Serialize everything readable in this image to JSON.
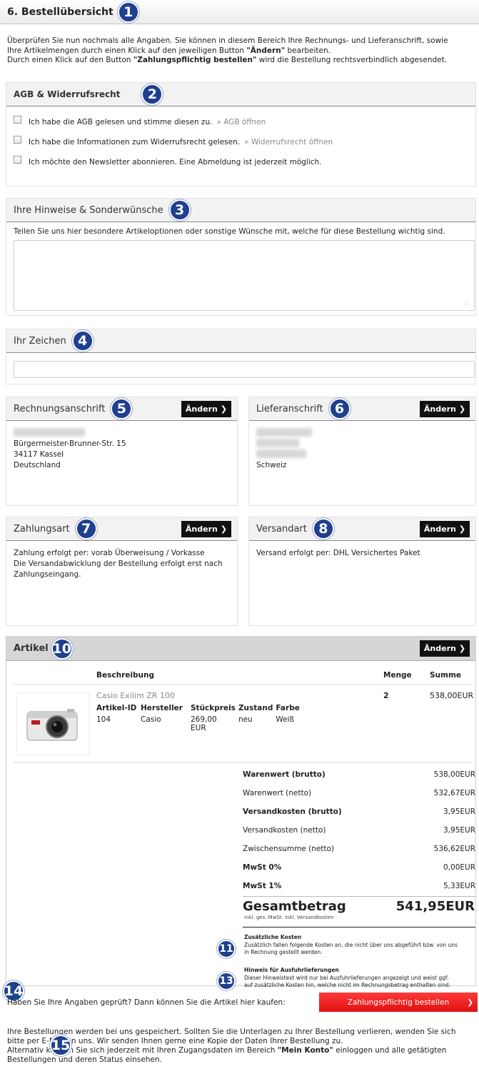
{
  "header": {
    "title": "6. Bestellübersicht",
    "badge": "1"
  },
  "intro": {
    "line1": "Überprüfen Sie nun nochmals alle Angaben. Sie können in diesem Bereich Ihre Rechnungs- und Lieferanschrift, sowie",
    "line2a": "Ihre Artikelmengen durch einen Klick auf den jeweiligen Button ",
    "line2b": "\"Ändern\"",
    "line2c": " bearbeiten.",
    "line3a": "Durch einen Klick auf den Button ",
    "line3b": "\"Zahlungspflichtig bestellen\"",
    "line3c": " wird die Bestellung rechtsverbindlich abgesendet."
  },
  "agb": {
    "title": "AGB & Widerrufsrecht",
    "badge": "2",
    "items": [
      {
        "label": "Ich habe die AGB gelesen und stimme diesen zu.",
        "link": "» AGB öffnen"
      },
      {
        "label": "Ich habe die Informationen zum Widerrufsrecht gelesen.",
        "link": "» Widerrufsrecht öffnen"
      },
      {
        "label": "Ich möchte den Newsletter abonnieren. Eine Abmeldung ist jederzeit möglich.",
        "link": ""
      }
    ]
  },
  "notes": {
    "title": "Ihre Hinweise & Sonderwünsche",
    "badge": "3",
    "desc": "Teilen Sie uns hier besondere Artikeloptionen oder sonstige Wünsche mit, welche für diese Bestellung wichtig sind.",
    "value": ""
  },
  "ref": {
    "title": "Ihr Zeichen",
    "badge": "4",
    "value": ""
  },
  "billing": {
    "title": "Rechnungsanschrift",
    "badge": "5",
    "button": "Ändern",
    "street": "Bürgermeister-Brunner-Str. 15",
    "city": "34117 Kassel",
    "country": "Deutschland"
  },
  "shipping": {
    "title": "Lieferanschrift",
    "badge": "6",
    "button": "Ändern",
    "country": "Schweiz"
  },
  "payment": {
    "title": "Zahlungsart",
    "badge": "7",
    "button": "Ändern",
    "line1": "Zahlung erfolgt per: vorab Überweisung / Vorkasse",
    "line2": "Die Versandabwicklung der Bestellung erfolgt erst nach",
    "line3": "Zahlungseingang."
  },
  "delivery": {
    "title": "Versandart",
    "badge": "8",
    "button": "Ändern",
    "line1": "Versand erfolgt per: DHL Versichertes Paket"
  },
  "articles": {
    "title": "Artikel",
    "badge": "10",
    "button": "Ändern",
    "headers": {
      "desc": "Beschreibung",
      "qty": "Menge",
      "sum": "Summe"
    },
    "item": {
      "name": "Casio Exilim ZR 100",
      "qty": "2",
      "sum": "538,00EUR",
      "attr_headers": [
        "Artikel-ID",
        "Hersteller",
        "Stückpreis",
        "Zustand",
        "Farbe"
      ],
      "attr_values": [
        "104",
        "Casio",
        "269,00",
        "neu",
        "Weiß"
      ],
      "price_unit": "EUR"
    },
    "totals": [
      {
        "label": "Warenwert (brutto)",
        "value": "538,00EUR",
        "bold": true
      },
      {
        "label": "Warenwert (netto)",
        "value": "532,67EUR",
        "bold": false
      },
      {
        "label": "Versandkosten (brutto)",
        "value": "3,95EUR",
        "bold": true
      },
      {
        "label": "Versandkosten (netto)",
        "value": "3,95EUR",
        "bold": false
      },
      {
        "label": "Zwischensumme (netto)",
        "value": "536,62EUR",
        "bold": false
      },
      {
        "label": "MwSt 0%",
        "value": "0,00EUR",
        "bold": true
      },
      {
        "label": "MwSt 1%",
        "value": "5,33EUR",
        "bold": true
      }
    ],
    "grand": {
      "label": "Gesamtbetrag",
      "sub": "inkl. ges. MwSt. inkl. Versandkosten",
      "value": "541,95EUR"
    },
    "extra": {
      "badge": "11",
      "title": "Zusätzliche Kosten",
      "text1": "Zusätzlich fallen folgende Kosten an, die nicht über uns abgeführt bzw. von uns",
      "text2": "in Rechnung gestellt werden."
    },
    "hint": {
      "badge": "13",
      "title": "Hinweis für Ausfuhrlieferungen",
      "text1": "Dieser Hinweistext wird nur bei Ausfuhrlieferungen angezeigt und weist ggf.",
      "text2": "auf zusätzliche Kosten hin, welche nicht im Rechnungsbetrag enthalten sind."
    }
  },
  "order": {
    "badge": "14",
    "question": "Haben Sie Ihre Angaben geprüft? Dann können Sie die Artikel hier kaufen:",
    "button": "Zahlungspflichtig bestellen"
  },
  "footer": {
    "badge": "15",
    "line1": "Ihre Bestellungen werden bei uns gespeichert. Sollten Sie die Unterlagen zu Ihrer Bestellung verlieren, wenden Sie sich",
    "line2": "bitte per E-Mail an uns. Wir senden Ihnen gerne eine Kopie der Daten Ihrer Bestellung zu.",
    "line3a": "Alternativ können Sie sich jederzeit mit Ihren Zugangsdaten im Bereich ",
    "line3b": "\"Mein Konto\"",
    "line3c": " einloggen und alle getätigten",
    "line4": "Bestellungen und deren Status einsehen."
  }
}
